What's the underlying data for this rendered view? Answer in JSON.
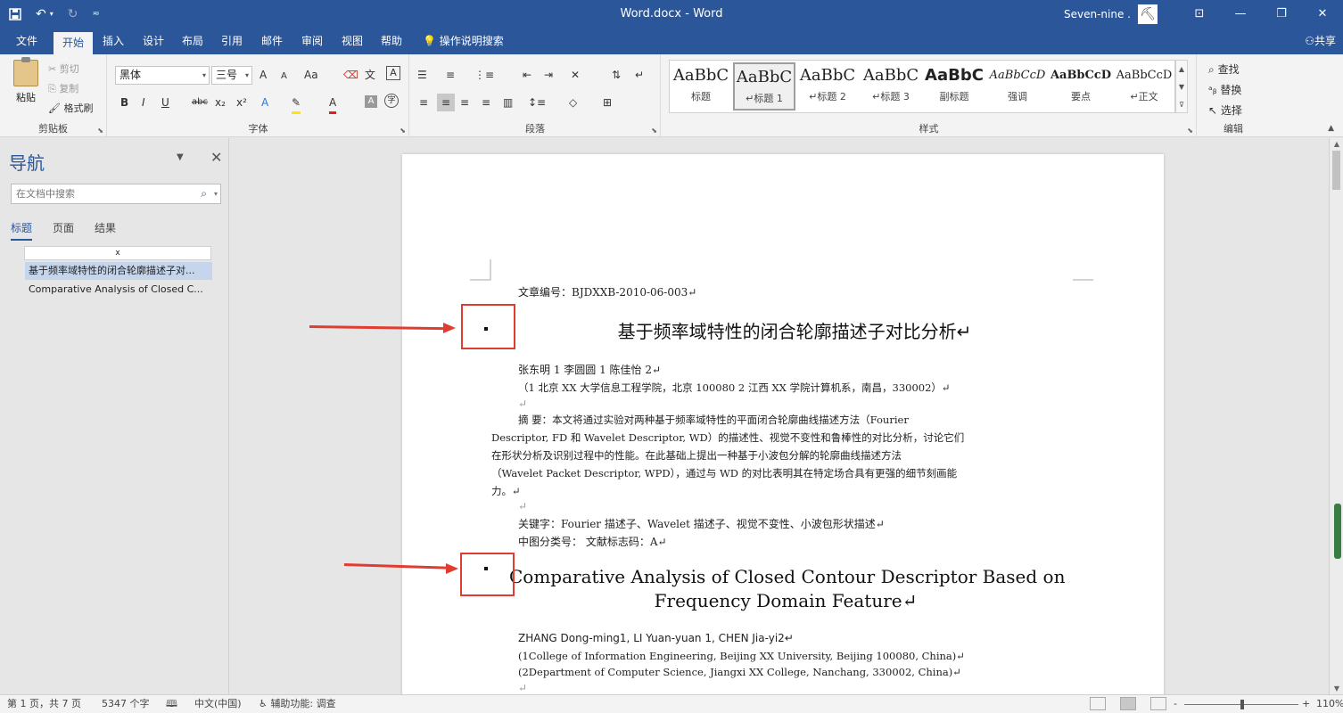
{
  "window": {
    "doc_title": "Word.docx  -  Word",
    "user": "Seven-nine .",
    "qat_more": "≂"
  },
  "ribbon_tabs": [
    "文件",
    "开始",
    "插入",
    "设计",
    "布局",
    "引用",
    "邮件",
    "审阅",
    "视图",
    "帮助"
  ],
  "active_tab": "开始",
  "tell_me": "操作说明搜索",
  "share": "共享",
  "clipboard": {
    "paste": "粘贴",
    "cut": "剪切",
    "copy": "复制",
    "format_painter": "格式刷",
    "label": "剪贴板"
  },
  "font": {
    "name": "黑体",
    "size": "三号",
    "label": "字体",
    "grow": "A",
    "shrink": "A",
    "change_case": "Aa",
    "bold": "B",
    "italic": "I",
    "underline": "U",
    "strike": "abc",
    "subscript": "x₂",
    "superscript": "x²",
    "text_effects": "A",
    "highlight": "✎",
    "font_color": "A",
    "char_shading": "A",
    "enclose": "字"
  },
  "paragraph": {
    "label": "段落"
  },
  "styles": {
    "label": "样式",
    "items": [
      {
        "sample": "AaBbC",
        "name": "标题"
      },
      {
        "sample": "AaBbC",
        "name": "↵标题 1"
      },
      {
        "sample": "AaBbC",
        "name": "↵标题 2"
      },
      {
        "sample": "AaBbC",
        "name": "↵标题 3"
      },
      {
        "sample": "AaBbC",
        "name": "副标题"
      },
      {
        "sample": "AaBbCcD",
        "name": "强调"
      },
      {
        "sample": "AaBbCcD",
        "name": "要点"
      },
      {
        "sample": "AaBbCcD",
        "name": "↵正文"
      }
    ]
  },
  "editing": {
    "find": "查找",
    "replace": "替换",
    "select": "选择",
    "label": "编辑"
  },
  "nav": {
    "title": "导航",
    "search_placeholder": "在文档中搜索",
    "tabs": [
      "标题",
      "页面",
      "结果"
    ],
    "headings": [
      "x",
      "基于频率域特性的闭合轮廓描述子对...",
      "Comparative Analysis of Closed C..."
    ]
  },
  "page": {
    "article_no": "文章编号：BJDXXB-2010-06-003↵",
    "title_cn": "基于频率域特性的闭合轮廓描述子对比分析↵",
    "authors_cn": "张东明 1    李圆圆 1  陈佳怡 2↵",
    "affil_cn": "（1 北京 XX 大学信息工程学院，北京  100080      2 江西 XX 学院计算机系，南昌，330002）↵",
    "blank1": "↵",
    "abstract_lines": [
      "摘    要：本文将通过实验对两种基于频率域特性的平面闭合轮廓曲线描述方法（Fourier",
      "Descriptor, FD 和 Wavelet Descriptor, WD）的描述性、视觉不变性和鲁棒性的对比分析，讨论它们",
      "在形状分析及识别过程中的性能。在此基础上提出一种基于小波包分解的轮廓曲线描述方法",
      "（Wavelet Packet Descriptor, WPD），通过与 WD 的对比表明其在特定场合具有更强的细节刻画能",
      "力。↵"
    ],
    "blank2": "↵",
    "keywords": "关键字：Fourier 描述子、Wavelet 描述子、视觉不变性、小波包形状描述↵",
    "classification": "中图分类号：              文献标志码：A↵",
    "title_en_1": "Comparative Analysis of Closed Contour Descriptor Based on",
    "title_en_2": "Frequency Domain Feature↵",
    "authors_en": "ZHANG Dong-ming1, LI Yuan-yuan 1, CHEN Jia-yi2↵",
    "affil_en_1": "(1College of Information Engineering, Beijing XX University, Beijing 100080, China)↵",
    "affil_en_2": "(2Department of Computer Science, Jiangxi XX College, Nanchang, 330002, China)↵",
    "blank3": "↵"
  },
  "status": {
    "page": "第 1 页，共 7 页",
    "words": "5347 个字",
    "language": "中文(中国)",
    "accessibility": "辅助功能: 调查",
    "zoom": "110%",
    "zoom_minus": "-",
    "zoom_plus": "+"
  },
  "colors": {
    "accent": "#2b579a",
    "annotation": "#e03c31"
  }
}
